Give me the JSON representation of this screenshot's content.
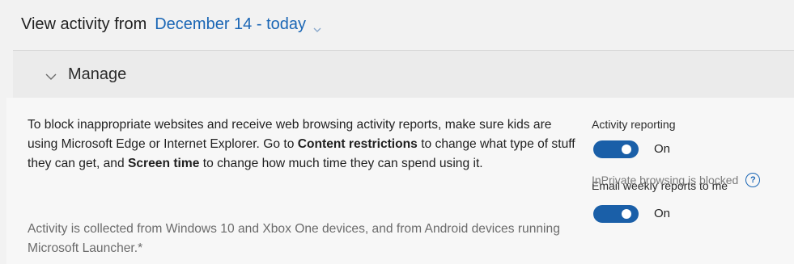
{
  "header": {
    "label": "View activity from",
    "date_range": "December 14 - today"
  },
  "manage": {
    "title": "Manage"
  },
  "description": {
    "part1": "To block inappropriate websites and receive web browsing activity reports, make sure kids are using Microsoft Edge or Internet Explorer. Go to ",
    "content_restrictions": "Content restrictions",
    "part2": " to change what type of stuff they can get, and ",
    "screen_time": "Screen time",
    "part3": " to change how much time they can spend using it."
  },
  "note": "Activity is collected from Windows 10 and Xbox One devices, and from Android devices running Microsoft Launcher.*",
  "settings": {
    "activity_reporting": {
      "label": "Activity reporting",
      "state": "On"
    },
    "email_reports": {
      "label": "Email weekly reports to me",
      "state": "On"
    },
    "inprivate": {
      "label": "InPrivate browsing is blocked",
      "help": "?"
    }
  },
  "colors": {
    "accent": "#1a66b5",
    "toggle_on": "#1a5fa8"
  }
}
